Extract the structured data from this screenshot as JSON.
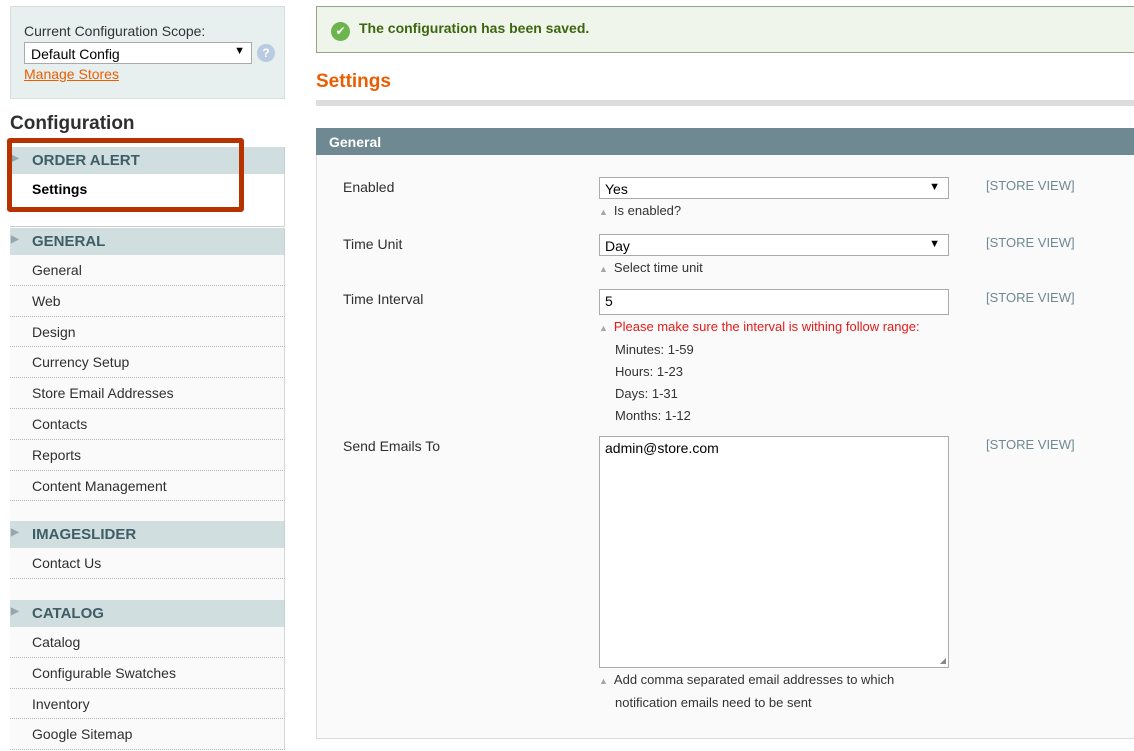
{
  "scope": {
    "label": "Current Configuration Scope:",
    "value": "Default Config",
    "manage_link": "Manage Stores"
  },
  "sidebar": {
    "title": "Configuration",
    "sections": [
      {
        "label": "ORDER ALERT",
        "items": [
          "Settings"
        ],
        "active": "Settings"
      },
      {
        "label": "GENERAL",
        "items": [
          "General",
          "Web",
          "Design",
          "Currency Setup",
          "Store Email Addresses",
          "Contacts",
          "Reports",
          "Content Management"
        ]
      },
      {
        "label": "IMAGESLIDER",
        "items": [
          "Contact Us"
        ]
      },
      {
        "label": "CATALOG",
        "items": [
          "Catalog",
          "Configurable Swatches",
          "Inventory",
          "Google Sitemap"
        ]
      }
    ]
  },
  "message": "The configuration has been saved.",
  "page_title": "Settings",
  "group_title": "General",
  "fields": [
    {
      "label": "Enabled",
      "type": "select",
      "value": "Yes",
      "scope": "[STORE VIEW]",
      "note": "Is enabled?"
    },
    {
      "label": "Time Unit",
      "type": "select",
      "value": "Day",
      "scope": "[STORE VIEW]",
      "note": "Select time unit"
    },
    {
      "label": "Time Interval",
      "type": "text",
      "value": "5",
      "scope": "[STORE VIEW]",
      "note": "Please make sure the interval is withing follow range:",
      "note_lines": [
        "Minutes: 1-59",
        "Hours: 1-23",
        "Days: 1-31",
        "Months: 1-12"
      ]
    },
    {
      "label": "Send Emails To",
      "type": "textarea",
      "value": "admin@store.com",
      "scope": "[STORE VIEW]",
      "note_lines": [
        "Add comma separated email addresses to which",
        "notification emails need to be sent"
      ]
    }
  ],
  "colors": {
    "accent": "#eb5e00",
    "header": "#6f8992",
    "highlight_box": "#b83200",
    "error": "#e41b1b"
  }
}
